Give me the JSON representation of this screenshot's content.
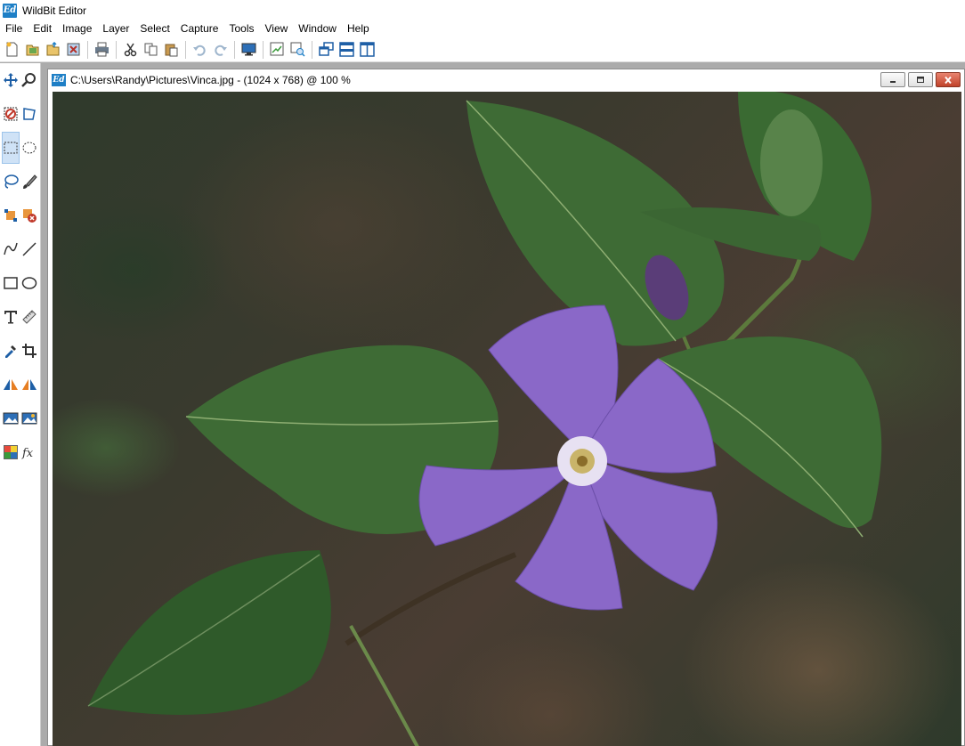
{
  "app": {
    "title": "WildBit Editor",
    "icon_text": "Ed"
  },
  "menu": [
    "File",
    "Edit",
    "Image",
    "Layer",
    "Select",
    "Capture",
    "Tools",
    "View",
    "Window",
    "Help"
  ],
  "toolbar": {
    "groups": [
      [
        "new-icon",
        "open-icon",
        "open-folder-icon",
        "close-image-icon"
      ],
      [
        "print-icon"
      ],
      [
        "cut-icon",
        "copy-icon",
        "paste-icon"
      ],
      [
        "undo-icon",
        "redo-icon"
      ],
      [
        "screen-capture-icon"
      ],
      [
        "zoom-fit-icon",
        "zoom-actual-icon"
      ],
      [
        "cascade-icon",
        "tile-horizontal-icon",
        "tile-vertical-icon"
      ]
    ]
  },
  "tools": [
    [
      "move-icon",
      "zoom-icon"
    ],
    [
      "no-select-icon",
      "perspective-icon"
    ],
    [
      "rect-select-icon",
      "ellipse-select-icon"
    ],
    [
      "lasso-icon",
      "brush-icon"
    ],
    [
      "select-shape-icon",
      "delete-shape-icon"
    ],
    [
      "curve-icon",
      "line-icon"
    ],
    [
      "rectangle-icon",
      "ellipse-icon"
    ],
    [
      "text-icon",
      "ruler-icon"
    ],
    [
      "eyedropper-icon",
      "crop-icon"
    ],
    [
      "flip-horizontal-icon",
      "flip-vertical-icon"
    ],
    [
      "image-adjust-icon",
      "image-resize-icon"
    ],
    [
      "color-palette-icon",
      "effects-icon"
    ]
  ],
  "document": {
    "title": "C:\\Users\\Randy\\Pictures\\Vinca.jpg - (1024 x 768) @ 100 %",
    "icon_text": "Ed"
  },
  "colors": {
    "accent": "#1e7fc6",
    "close_button": "#c0422a",
    "selected_tool": "#cfe2f6"
  }
}
